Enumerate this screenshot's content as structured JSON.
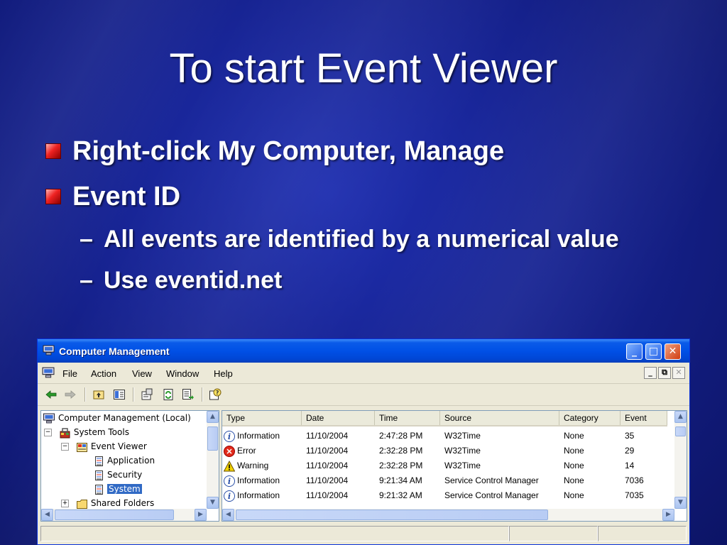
{
  "slide": {
    "title": "To start Event Viewer",
    "bullets": [
      {
        "text": "Right-click My Computer,  Manage"
      },
      {
        "text": "Event ID"
      }
    ],
    "sub_bullets": [
      {
        "dash": "–",
        "text": "All events are identified by a numerical value"
      },
      {
        "dash": "–",
        "text": "Use eventid.net"
      }
    ]
  },
  "window": {
    "title": "Computer Management",
    "controls": {
      "minimize": "_",
      "maximize": "□",
      "close": "✕"
    },
    "menu": [
      "File",
      "Action",
      "View",
      "Window",
      "Help"
    ],
    "mdi_controls": [
      "_",
      "⧉",
      "✕"
    ],
    "colors": {
      "title_bar": "#0050e6",
      "selection": "#316ac5",
      "error": "#e02a1a",
      "warning": "#f2d300"
    },
    "tree": [
      {
        "label": "Computer Management (Local)",
        "icon": "computer-icon",
        "expander": ""
      },
      {
        "label": "System Tools",
        "icon": "toolbox-icon",
        "expander": "−"
      },
      {
        "label": "Event Viewer",
        "icon": "event-viewer-icon",
        "expander": "−"
      },
      {
        "label": "Application",
        "icon": "log-icon",
        "expander": ""
      },
      {
        "label": "Security",
        "icon": "log-icon",
        "expander": ""
      },
      {
        "label": "System",
        "icon": "log-icon",
        "expander": "",
        "selected": true
      },
      {
        "label": "Shared Folders",
        "icon": "folder-icon",
        "expander": "+"
      }
    ],
    "columns": [
      "Type",
      "Date",
      "Time",
      "Source",
      "Category",
      "Event"
    ],
    "events": [
      {
        "type": "Information",
        "icon": "info",
        "date": "11/10/2004",
        "time": "2:47:28 PM",
        "source": "W32Time",
        "category": "None",
        "event": "35"
      },
      {
        "type": "Error",
        "icon": "error",
        "date": "11/10/2004",
        "time": "2:32:28 PM",
        "source": "W32Time",
        "category": "None",
        "event": "29"
      },
      {
        "type": "Warning",
        "icon": "warning",
        "date": "11/10/2004",
        "time": "2:32:28 PM",
        "source": "W32Time",
        "category": "None",
        "event": "14"
      },
      {
        "type": "Information",
        "icon": "info",
        "date": "11/10/2004",
        "time": "9:21:34 AM",
        "source": "Service Control Manager",
        "category": "None",
        "event": "7036"
      },
      {
        "type": "Information",
        "icon": "info",
        "date": "11/10/2004",
        "time": "9:21:32 AM",
        "source": "Service Control Manager",
        "category": "None",
        "event": "7035"
      }
    ]
  }
}
